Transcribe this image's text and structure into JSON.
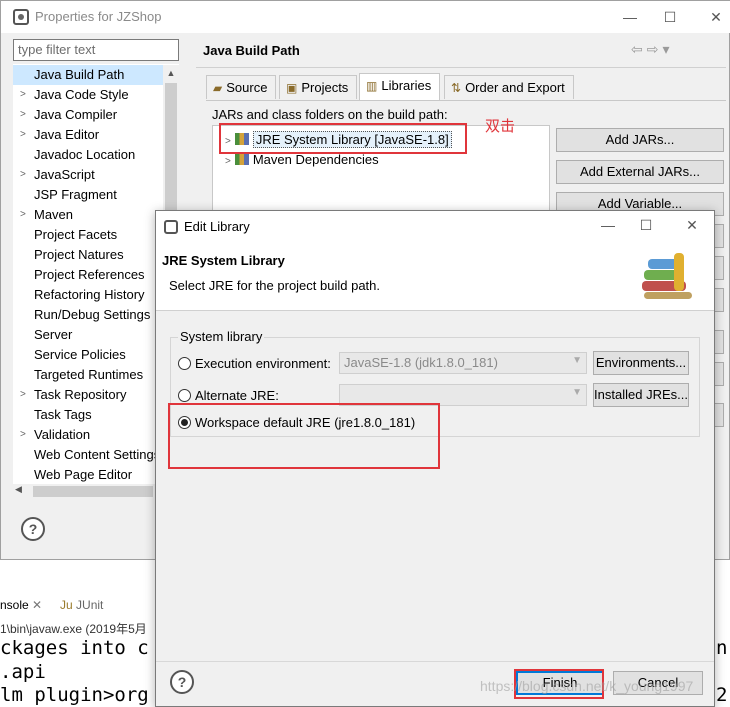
{
  "props_window": {
    "title": "Properties for JZShop",
    "filter_placeholder": "type filter text",
    "tree_items": [
      {
        "label": "Java Build Path",
        "expandable": false,
        "selected": true
      },
      {
        "label": "Java Code Style",
        "expandable": true
      },
      {
        "label": "Java Compiler",
        "expandable": true
      },
      {
        "label": "Java Editor",
        "expandable": true
      },
      {
        "label": "Javadoc Location",
        "expandable": false
      },
      {
        "label": "JavaScript",
        "expandable": true
      },
      {
        "label": "JSP Fragment",
        "expandable": false
      },
      {
        "label": "Maven",
        "expandable": true
      },
      {
        "label": "Project Facets",
        "expandable": false
      },
      {
        "label": "Project Natures",
        "expandable": false
      },
      {
        "label": "Project References",
        "expandable": false
      },
      {
        "label": "Refactoring History",
        "expandable": false
      },
      {
        "label": "Run/Debug Settings",
        "expandable": false
      },
      {
        "label": "Server",
        "expandable": false
      },
      {
        "label": "Service Policies",
        "expandable": false
      },
      {
        "label": "Targeted Runtimes",
        "expandable": false
      },
      {
        "label": "Task Repository",
        "expandable": true
      },
      {
        "label": "Task Tags",
        "expandable": false
      },
      {
        "label": "Validation",
        "expandable": true
      },
      {
        "label": "Web Content Settings",
        "expandable": false
      },
      {
        "label": "Web Page Editor",
        "expandable": false
      }
    ],
    "panel_title": "Java Build Path",
    "tabs": [
      {
        "label": "Source",
        "icon": "source-folder-icon"
      },
      {
        "label": "Projects",
        "icon": "projects-icon"
      },
      {
        "label": "Libraries",
        "icon": "libraries-icon",
        "active": true
      },
      {
        "label": "Order and Export",
        "icon": "order-export-icon"
      }
    ],
    "jars_label": "JARs and class folders on the build path:",
    "libraries": [
      {
        "label": "JRE System Library [JavaSE-1.8]",
        "selected": true
      },
      {
        "label": "Maven Dependencies"
      }
    ],
    "side_buttons": [
      "Add JARs...",
      "Add External JARs...",
      "Add Variable..."
    ],
    "annotation": "双击"
  },
  "console": {
    "tab_console": "nsole",
    "tab_junit": "JUnit",
    "path": "1\\bin\\javaw.exe (2019年5月",
    "lines": [
      "ckages into c",
      ".api",
      "lm plugin>org"
    ],
    "right_chars": [
      "n",
      "2"
    ]
  },
  "dialog": {
    "title": "Edit Library",
    "header_title": "JRE System Library",
    "header_desc": "Select JRE for the project build path.",
    "group_label": "System library",
    "options": [
      {
        "label": "Execution environment:",
        "selected": false,
        "combo": "JavaSE-1.8 (jdk1.8.0_181)",
        "button": "Environments..."
      },
      {
        "label": "Alternate JRE:",
        "selected": false,
        "combo": "",
        "button": "Installed JREs..."
      },
      {
        "label": "Workspace default JRE (jre1.8.0_181)",
        "selected": true
      }
    ],
    "finish_label": "Finish",
    "cancel_label": "Cancel"
  },
  "watermark": "https://blog.csdn.net/k_young1997"
}
